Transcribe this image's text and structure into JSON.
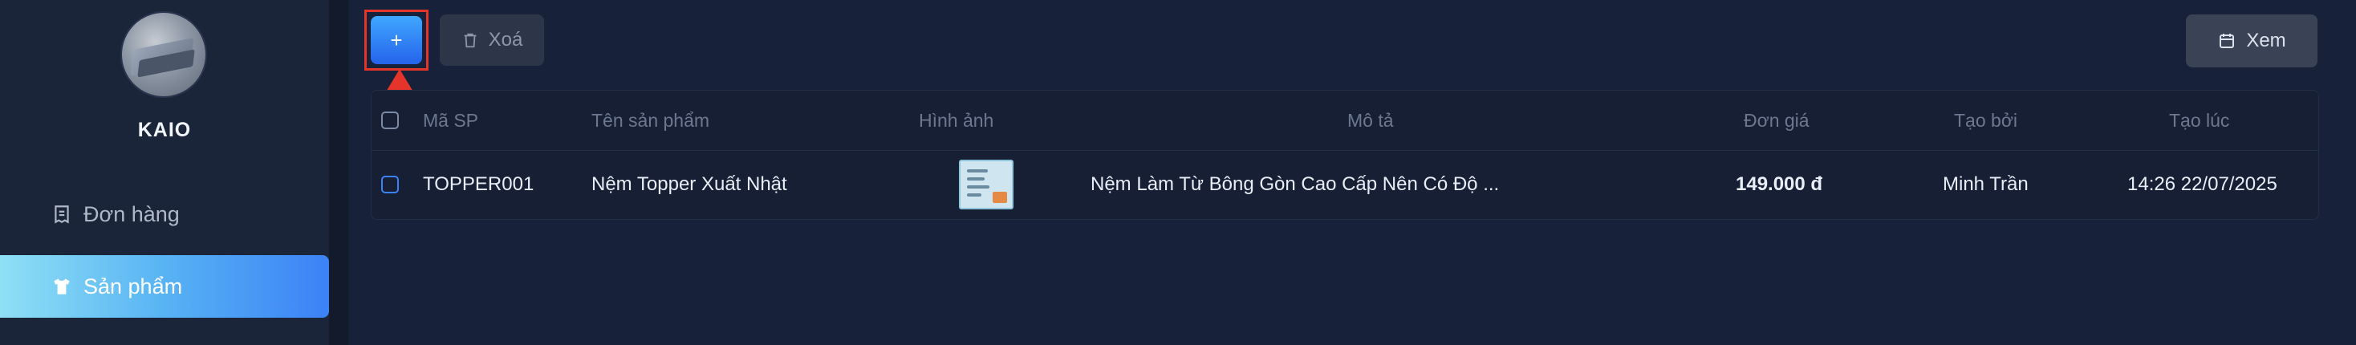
{
  "sidebar": {
    "brand": "KAIO",
    "items": [
      {
        "label": "Đơn hàng",
        "icon": "receipt-icon",
        "active": false
      },
      {
        "label": "Sản phẩm",
        "icon": "shirt-icon",
        "active": true
      }
    ]
  },
  "toolbar": {
    "add_label": "+",
    "delete_label": "Xoá",
    "view_label": "Xem"
  },
  "table": {
    "columns": [
      "Mã SP",
      "Tên sản phẩm",
      "Hình ảnh",
      "Mô tả",
      "Đơn giá",
      "Tạo bởi",
      "Tạo lúc"
    ],
    "rows": [
      {
        "code": "TOPPER001",
        "name": "Nệm Topper Xuất Nhật",
        "description": "Nệm Làm Từ Bông Gòn Cao Cấp Nên Có Độ ...",
        "price": "149.000 đ",
        "created_by": "Minh Trần",
        "created_at": "14:26 22/07/2025"
      }
    ]
  },
  "colors": {
    "accent": "#3b82f6",
    "highlight": "#e5352b",
    "background": "#121a2c"
  }
}
